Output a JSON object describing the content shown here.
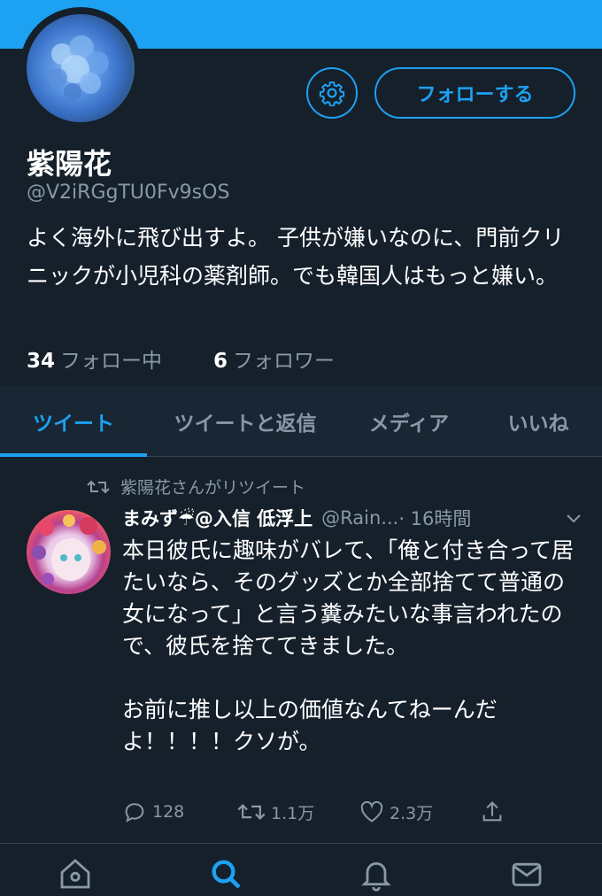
{
  "profile": {
    "display_name": "紫陽花",
    "handle": "@V2iRGgTU0Fv9sOS",
    "bio": "よく海外に飛び出すよ。 子供が嫌いなのに、門前クリニックが小児科の薬剤師。でも韓国人はもっと嫌い。",
    "following_count": "34",
    "following_label": "フォロー中",
    "followers_count": "6",
    "followers_label": "フォロワー",
    "follow_button_label": "フォローする",
    "avatar_icon": "hydrangea-photo",
    "settings_icon": "gear-icon"
  },
  "tabs": [
    {
      "label": "ツイート",
      "active": true
    },
    {
      "label": "ツイートと返信",
      "active": false
    },
    {
      "label": "メディア",
      "active": false
    },
    {
      "label": "いいね",
      "active": false
    }
  ],
  "tweet": {
    "retweet_note": "紫陽花さんがリツイート",
    "author_name": "まみず☔@入信 低浮上",
    "author_handle": "@Rain...",
    "time": "· 16時間",
    "body": "本日彼氏に趣味がバレて、「俺と付き合って居たいなら、そのグッズとか全部捨てて普通の女になって」と言う糞みたいな事言われたので、彼氏を捨ててきました。\n\nお前に推し以上の価値なんてねーんだよ！！！！クソが。",
    "replies": "128",
    "retweets": "1.1万",
    "likes": "2.3万"
  },
  "colors": {
    "accent": "#1da1f2",
    "background": "#15202b",
    "secondary_text": "#8899a6"
  }
}
